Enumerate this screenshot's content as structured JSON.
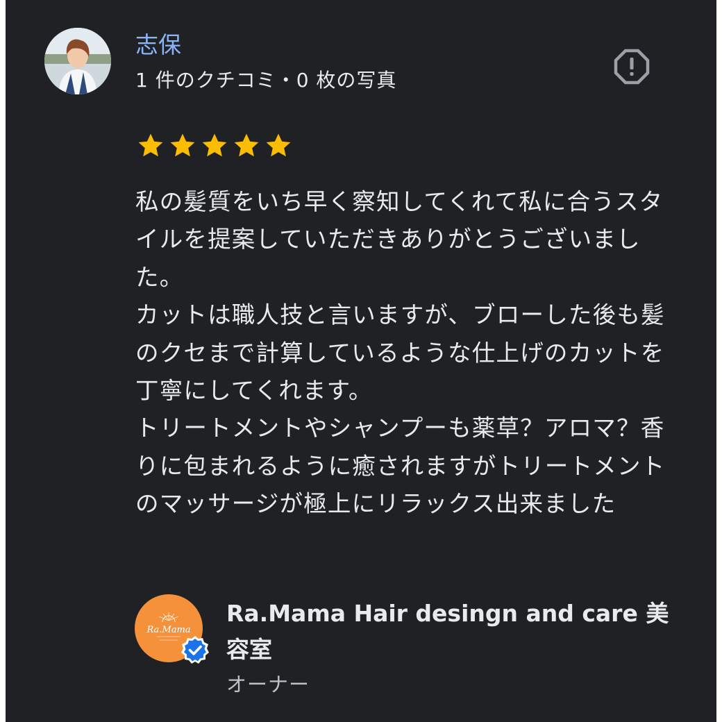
{
  "reviewer": {
    "name": "志保",
    "meta": "1 件のクチコミ・0 枚の写真",
    "avatar_icon": "reviewer-avatar-photo"
  },
  "report_icon": "report-icon",
  "rating": {
    "stars": 5,
    "max": 5,
    "color": "#fbbc04"
  },
  "review": {
    "text": "私の髪質をいち早く察知してくれて私に合うスタイルを提案していただきありがとうございました。\nカットは職人技と言いますが、ブローした後も髪のクセまで計算しているような仕上げのカットを丁寧にしてくれます。\nトリートメントやシャンプーも薬草？アロマ？香りに包まれるように癒されますがトリートメントのマッサージが極上にリラックス出来ました"
  },
  "owner": {
    "name": "Ra.Mama Hair desingn and care 美容室",
    "role": "オーナー",
    "logo_text": "Ra.Mama",
    "logo_color": "#f5913a",
    "badge_icon": "verified-badge-icon",
    "badge_color": "#1a73e8"
  },
  "colors": {
    "background": "#202124",
    "name_link": "#8ab4f8",
    "text": "#e8eaed",
    "secondary_text": "#bdc1c6"
  }
}
